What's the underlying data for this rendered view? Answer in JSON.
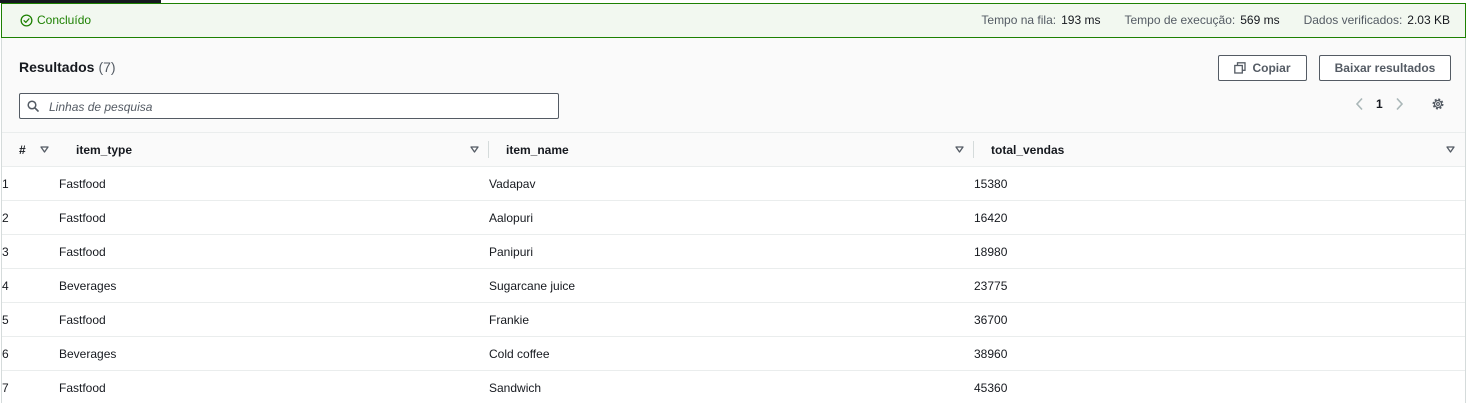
{
  "status": {
    "label": "Concluído",
    "color": "#1d8102",
    "metrics": [
      {
        "label": "Tempo na fila:",
        "value": "193 ms"
      },
      {
        "label": "Tempo de execução:",
        "value": "569 ms"
      },
      {
        "label": "Dados verificados:",
        "value": "2.03 KB"
      }
    ]
  },
  "results": {
    "title": "Resultados",
    "count": "(7)",
    "copy_label": "Copiar",
    "download_label": "Baixar resultados",
    "search_placeholder": "Linhas de pesquisa",
    "page": "1"
  },
  "table": {
    "columns": [
      "#",
      "item_type",
      "item_name",
      "total_vendas"
    ],
    "rows": [
      [
        "1",
        "Fastfood",
        "Vadapav",
        "15380"
      ],
      [
        "2",
        "Fastfood",
        "Aalopuri",
        "16420"
      ],
      [
        "3",
        "Fastfood",
        "Panipuri",
        "18980"
      ],
      [
        "4",
        "Beverages",
        "Sugarcane juice",
        "23775"
      ],
      [
        "5",
        "Fastfood",
        "Frankie",
        "36700"
      ],
      [
        "6",
        "Beverages",
        "Cold coffee",
        "38960"
      ],
      [
        "7",
        "Fastfood",
        "Sandwich",
        "45360"
      ]
    ]
  },
  "icons": {
    "status": "check-circle-icon",
    "copy": "copy-icon",
    "search": "search-icon",
    "prev": "chevron-left-icon",
    "next": "chevron-right-icon",
    "settings": "gear-icon",
    "filter": "caret-down-icon"
  }
}
